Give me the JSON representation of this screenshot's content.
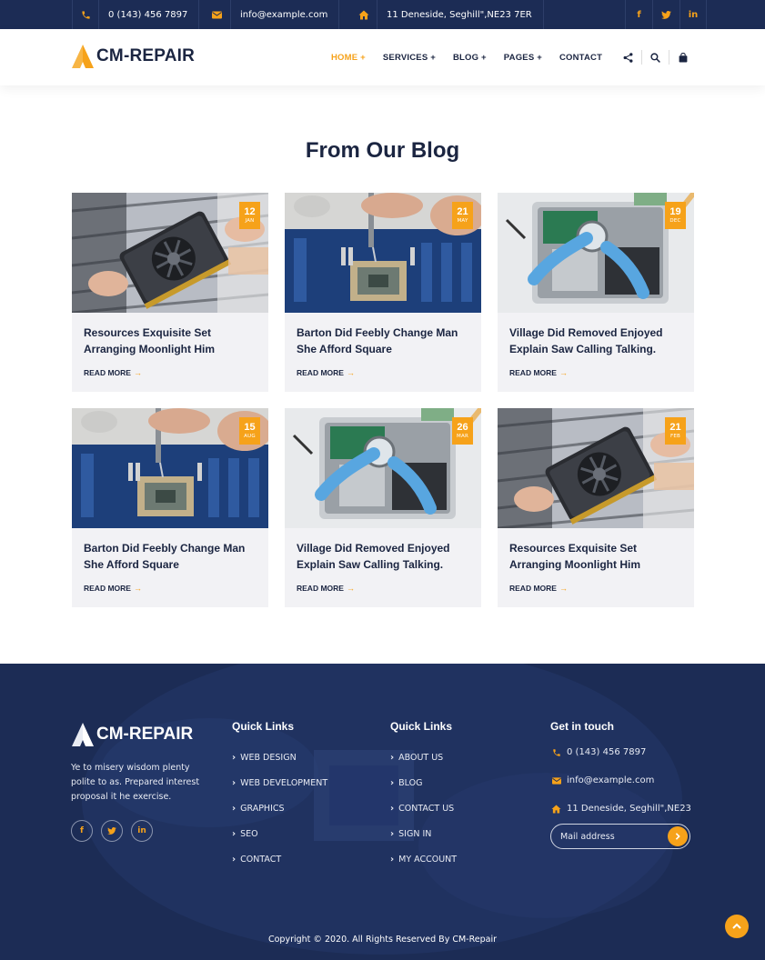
{
  "topbar": {
    "phone": "0 (143) 456 7897",
    "email": "info@example.com",
    "address": "11 Deneside, Seghill\",NE23 7ER",
    "social": [
      "f",
      "t",
      "in"
    ]
  },
  "brand": {
    "name": "CM-REPAIR",
    "accent": "#f6a21a",
    "navy": "#1c2c55"
  },
  "nav": {
    "items": [
      "HOME +",
      "SERVICES +",
      "BLOG +",
      "PAGES +",
      "CONTACT"
    ]
  },
  "blog": {
    "heading": "From Our Blog",
    "read_more": "READ MORE",
    "cards": [
      {
        "day": "12",
        "month": "JAN",
        "title": "Resources Exquisite Set Arranging Moonlight Him"
      },
      {
        "day": "21",
        "month": "MAY",
        "title": "Barton Did Feebly Change Man She Afford Square"
      },
      {
        "day": "19",
        "month": "DEC",
        "title": "Village Did Removed Enjoyed Explain Saw Calling Talking."
      },
      {
        "day": "15",
        "month": "AUG",
        "title": "Barton Did Feebly Change Man She Afford Square"
      },
      {
        "day": "26",
        "month": "MAR",
        "title": "Village Did Removed Enjoyed Explain Saw Calling Talking."
      },
      {
        "day": "21",
        "month": "FEB",
        "title": "Resources Exquisite Set Arranging Moonlight Him"
      }
    ]
  },
  "footer": {
    "about": "Ye to misery wisdom plenty polite to as. Prepared interest proposal it he exercise.",
    "social": [
      "f",
      "t",
      "in"
    ],
    "col1": {
      "heading": "Quick Links",
      "links": [
        "WEB DESIGN",
        "WEB DEVELOPMENT",
        "GRAPHICS",
        "SEO",
        "CONTACT"
      ]
    },
    "col2": {
      "heading": "Quick Links",
      "links": [
        "ABOUT US",
        "BLOG",
        "CONTACT US",
        "SIGN IN",
        "MY ACCOUNT"
      ]
    },
    "contact": {
      "heading": "Get in touch",
      "phone": "0 (143) 456 7897",
      "email": "info@example.com",
      "address": "11 Deneside, Seghill\",NE23"
    },
    "newsletter_placeholder": "Mail address",
    "copyright": "Copyright © 2020. All Rights Reserved By CM-Repair"
  }
}
